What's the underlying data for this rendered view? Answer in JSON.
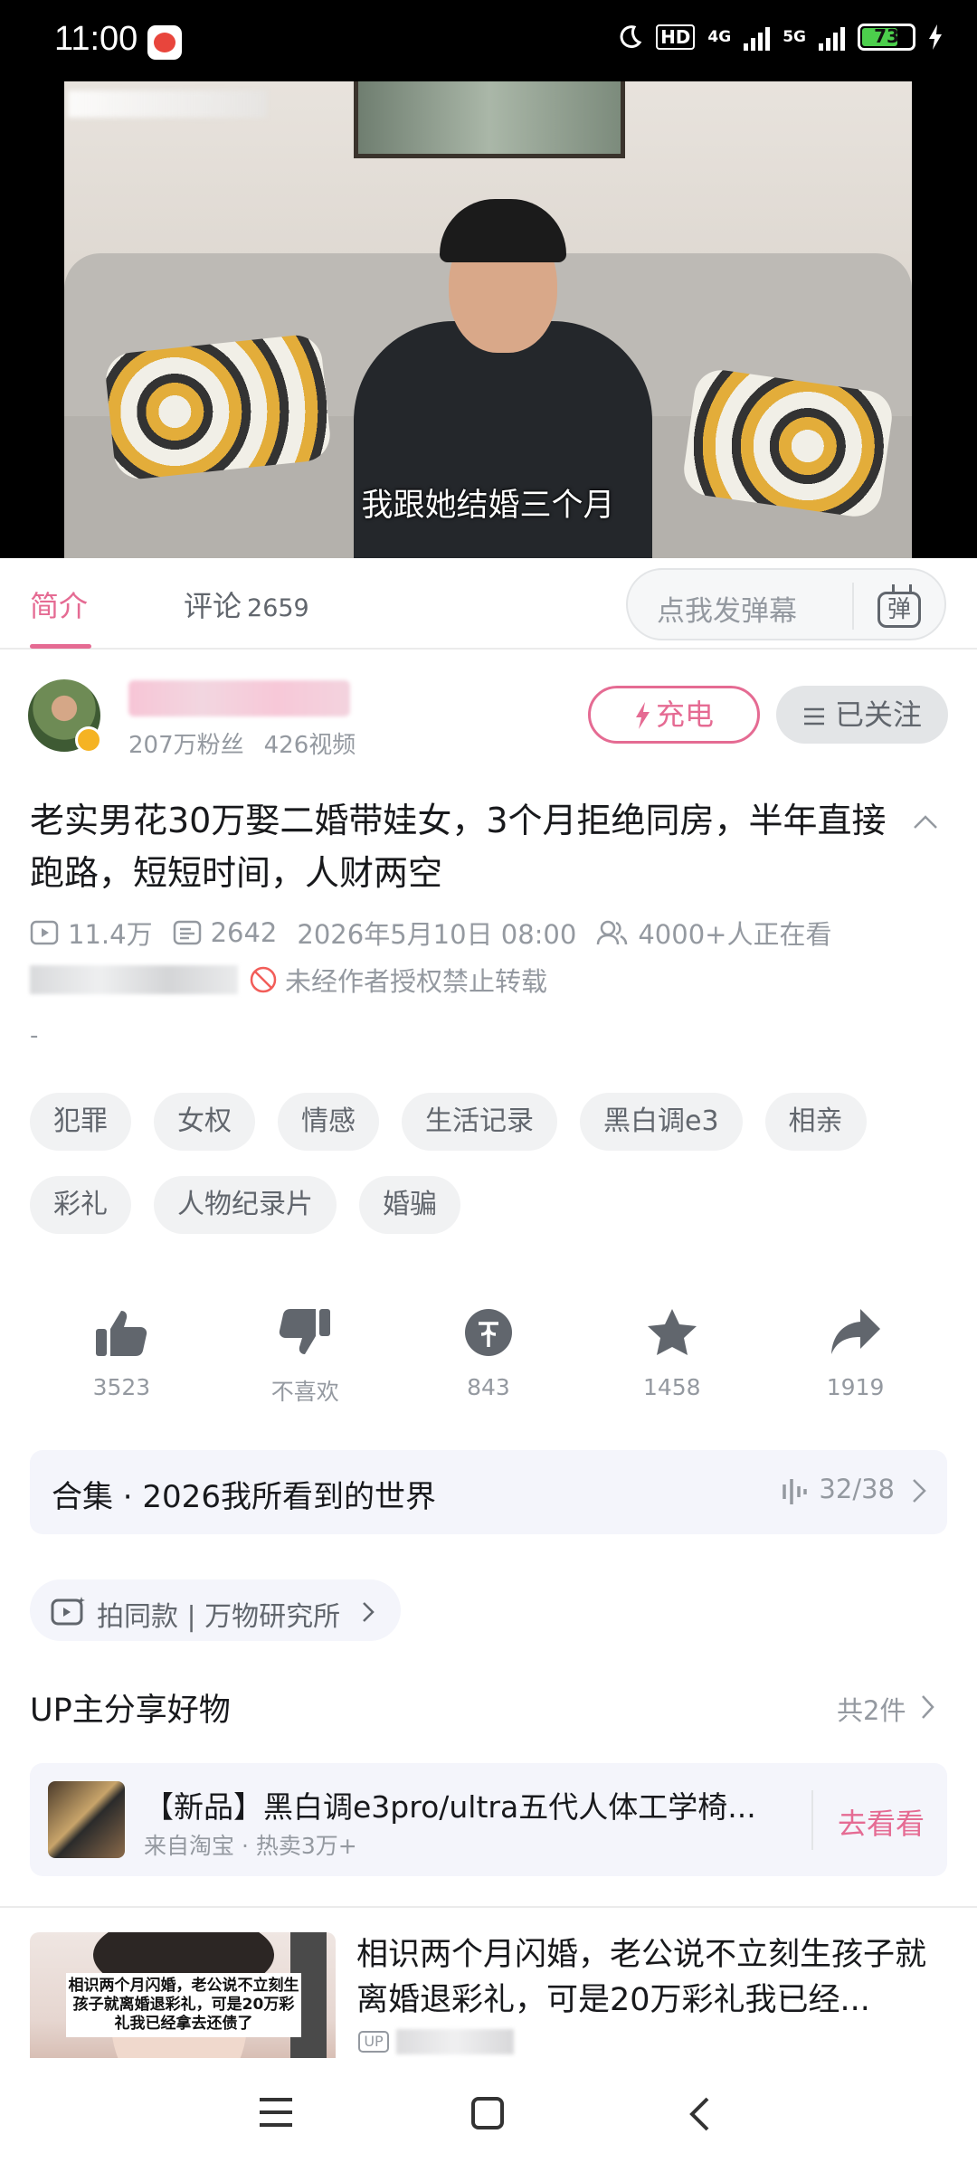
{
  "status_bar": {
    "time": "11:00",
    "network_1": "4G",
    "network_2": "5G",
    "hd_label": "HD",
    "battery": "73"
  },
  "video": {
    "subtitle": "我跟她结婚三个月"
  },
  "tabs": {
    "intro": "简介",
    "comments": "评论",
    "comments_count": "2659",
    "danmaku_placeholder": "点我发弹幕",
    "danmaku_button": "弹"
  },
  "uploader": {
    "fans": "207万粉丝",
    "videos": "426视频",
    "charge_label": "充电",
    "follow_label": "已关注"
  },
  "video_info": {
    "title": "老实男花30万娶二婚带娃女，3个月拒绝同房，半年直接跑路，短短时间，人财两空",
    "views": "11.4万",
    "danmaku_count": "2642",
    "publish_time": "2026年5月10日 08:00",
    "watching": "4000+人正在看",
    "no_repost": "未经作者授权禁止转载",
    "description": "-"
  },
  "tags": [
    "犯罪",
    "女权",
    "情感",
    "生活记录",
    "黑白调e3",
    "相亲",
    "彩礼",
    "人物纪录片",
    "婚骗"
  ],
  "actions": {
    "like": "3523",
    "dislike": "不喜欢",
    "coin": "843",
    "favorite": "1458",
    "share": "1919"
  },
  "collection": {
    "label": "合集 · 2026我所看到的世界",
    "progress": "32/38"
  },
  "same_style": {
    "label": "拍同款 | 万物研究所"
  },
  "goods": {
    "section_title": "UP主分享好物",
    "count": "共2件",
    "item_name": "【新品】黑白调e3pro/ultra五代人体工学椅...",
    "item_source": "来自淘宝 · 热卖3万+",
    "item_action": "去看看"
  },
  "recommended": {
    "title": "相识两个月闪婚，老公说不立刻生孩子就离婚退彩礼，可是20万彩礼我已经...",
    "thumb_caption": "相识两个月闪婚，老公说不立刻生孩子就离婚退彩礼，可是20万彩礼我已经拿去还债了",
    "up_badge": "UP"
  },
  "colors": {
    "accent": "#e56b93",
    "text_primary": "#18191c",
    "text_secondary": "#9499a0"
  },
  "icons": {
    "battery_level": 0.73
  }
}
